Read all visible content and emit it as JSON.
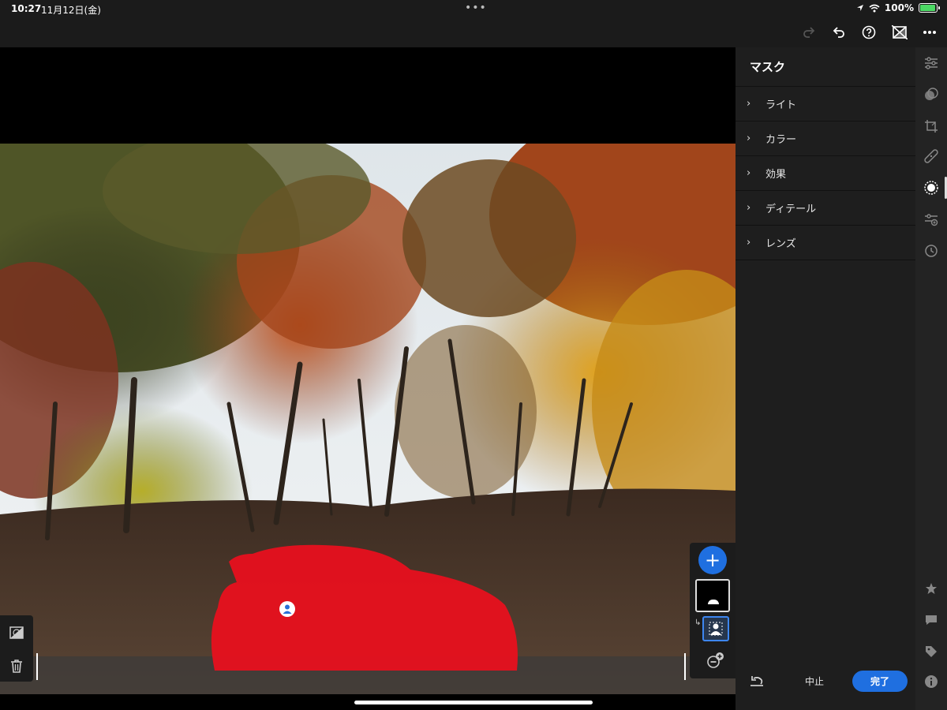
{
  "status_bar": {
    "time": "10:27",
    "date": "11月12日(金)",
    "dots": "•••",
    "battery": "100%",
    "battery_level": 1.0
  },
  "toolbar": {
    "icons": [
      "redo-icon",
      "undo-icon",
      "help-icon",
      "compare-icon",
      "more-icon"
    ]
  },
  "panel": {
    "title": "マスク",
    "items": [
      {
        "label": "ライト"
      },
      {
        "label": "カラー"
      },
      {
        "label": "効果"
      },
      {
        "label": "ディテール"
      },
      {
        "label": "レンズ"
      }
    ],
    "cancel_label": "中止",
    "done_label": "完了"
  },
  "mask_tools": {
    "add_label": "+"
  },
  "colors": {
    "accent": "#1f6fe0",
    "mask_overlay": "#e8101e",
    "panel_bg": "#1e1e1e"
  }
}
